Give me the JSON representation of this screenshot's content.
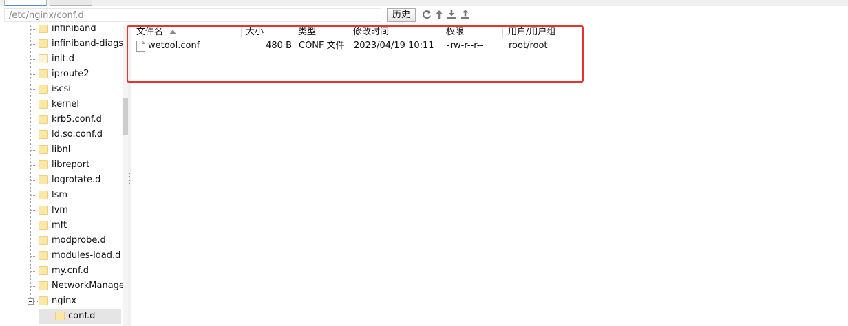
{
  "address_bar": {
    "path": "/etc/nginx/conf.d",
    "history_label": "历史",
    "tool_icons": [
      "refresh-icon",
      "go-up-icon",
      "download-icon",
      "upload-icon"
    ]
  },
  "tree": {
    "items": [
      {
        "label": "infiniband"
      },
      {
        "label": "infiniband-diags"
      },
      {
        "label": "init.d"
      },
      {
        "label": "iproute2"
      },
      {
        "label": "iscsi"
      },
      {
        "label": "kernel"
      },
      {
        "label": "krb5.conf.d"
      },
      {
        "label": "ld.so.conf.d"
      },
      {
        "label": "libnl"
      },
      {
        "label": "libreport"
      },
      {
        "label": "logrotate.d"
      },
      {
        "label": "lsm"
      },
      {
        "label": "lvm"
      },
      {
        "label": "mft"
      },
      {
        "label": "modprobe.d"
      },
      {
        "label": "modules-load.d"
      },
      {
        "label": "my.cnf.d"
      },
      {
        "label": "NetworkManage"
      },
      {
        "label": "nginx"
      },
      {
        "label": "conf.d"
      }
    ]
  },
  "file_list": {
    "columns": [
      "文件名",
      "大小",
      "类型",
      "修改时间",
      "权限",
      "用户/用户组"
    ],
    "sorted_by": "文件名",
    "rows": [
      {
        "name": "wetool.conf",
        "size": "480 B",
        "type": "CONF 文件",
        "modified": "2023/04/19 10:11",
        "permissions": "-rw-r--r--",
        "owner": "root/root"
      }
    ]
  },
  "colors": {
    "highlight_border": "#e8322f",
    "folder_fill": "#fce7a5",
    "selection": "#e5e5e5"
  }
}
